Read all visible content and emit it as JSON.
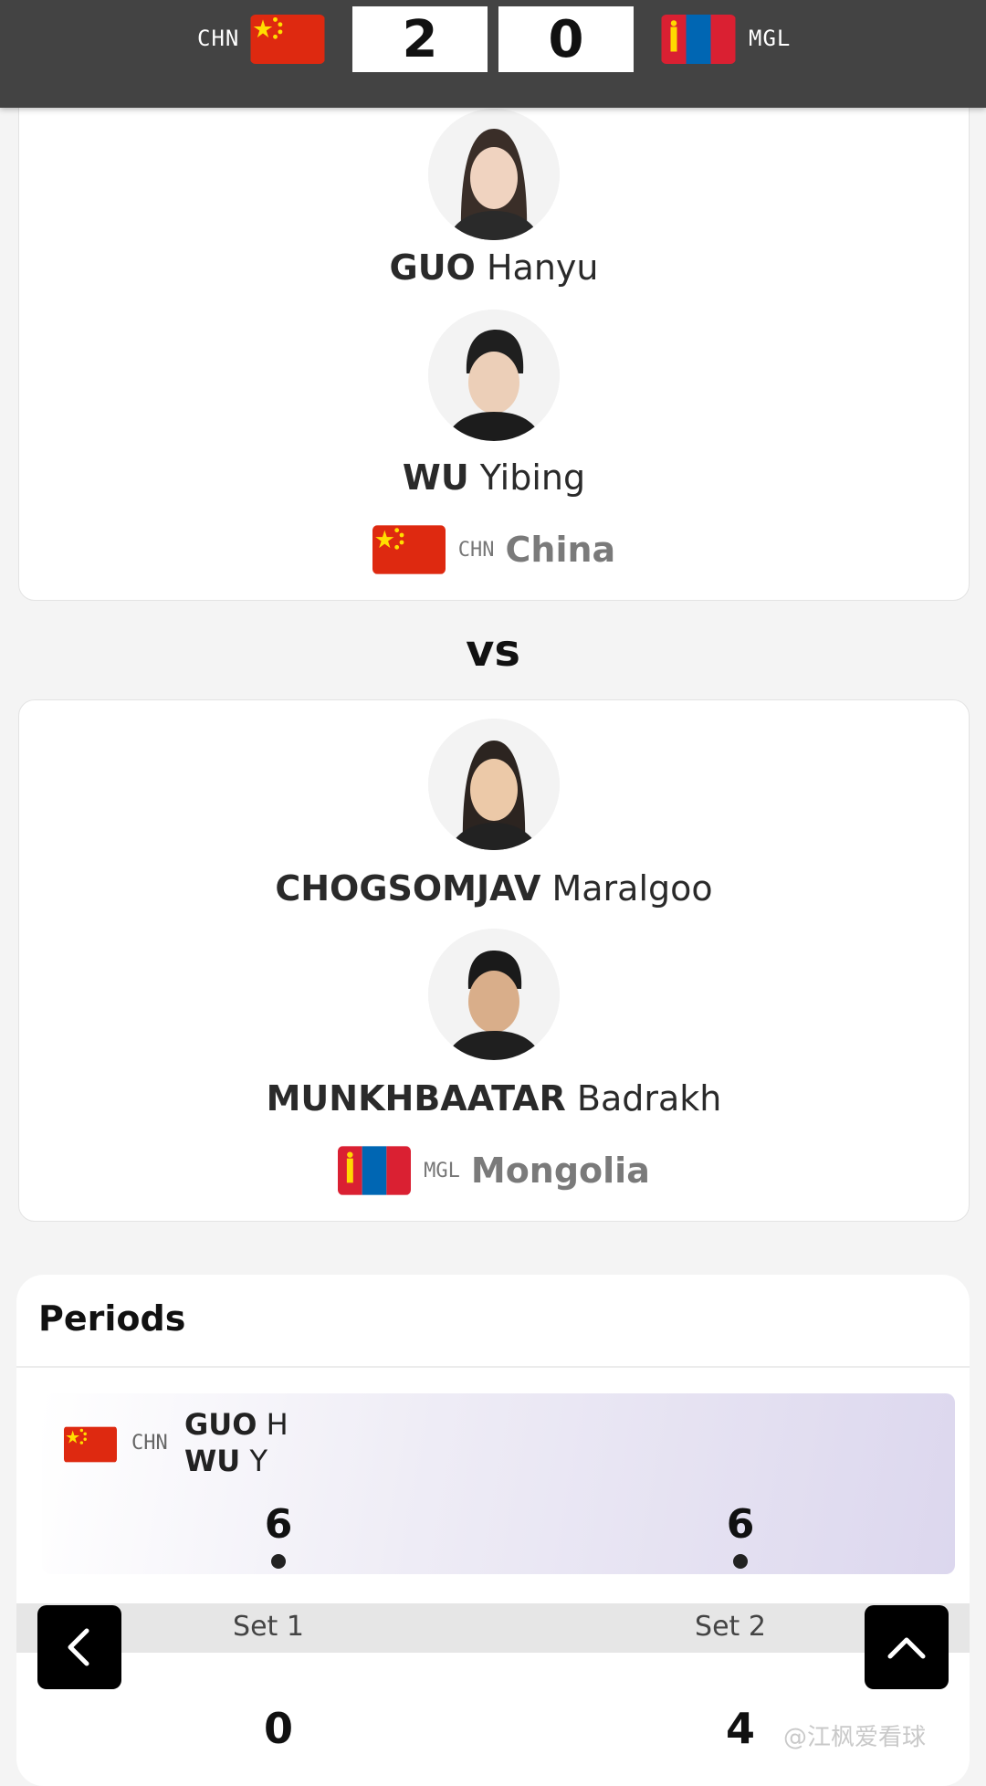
{
  "scorebar": {
    "home_code": "CHN",
    "away_code": "MGL",
    "home_score": "2",
    "away_score": "0"
  },
  "team_a": {
    "players": [
      {
        "surname": "GUO",
        "given": "Hanyu"
      },
      {
        "surname": "WU",
        "given": "Yibing"
      }
    ],
    "nation_code": "CHN",
    "nation_name": "China"
  },
  "vs_label": "vs",
  "team_b": {
    "players": [
      {
        "surname": "CHOGSOMJAV",
        "given": "Maralgoo"
      },
      {
        "surname": "MUNKHBAATAR",
        "given": "Badrakh"
      }
    ],
    "nation_code": "MGL",
    "nation_name": "Mongolia"
  },
  "periods": {
    "title": "Periods",
    "team_row": {
      "code": "CHN",
      "p1_surname": "GUO",
      "p1_initial": "H",
      "p2_surname": "WU",
      "p2_initial": "Y",
      "set_scores": [
        "6",
        "6"
      ]
    },
    "set_labels": [
      "Set 1",
      "Set 2"
    ],
    "opponent_set_scores": [
      "0",
      "4"
    ]
  },
  "watermark": "@江枫爱看球",
  "colors": {
    "china_red": "#de2910",
    "china_star": "#ffde00",
    "mongolia_red": "#da2032",
    "mongolia_blue": "#0066b3",
    "soyombo_gold": "#ffd900",
    "topbar_bg": "#434343"
  },
  "icons": [
    "back-arrow-icon",
    "scroll-up-icon"
  ]
}
